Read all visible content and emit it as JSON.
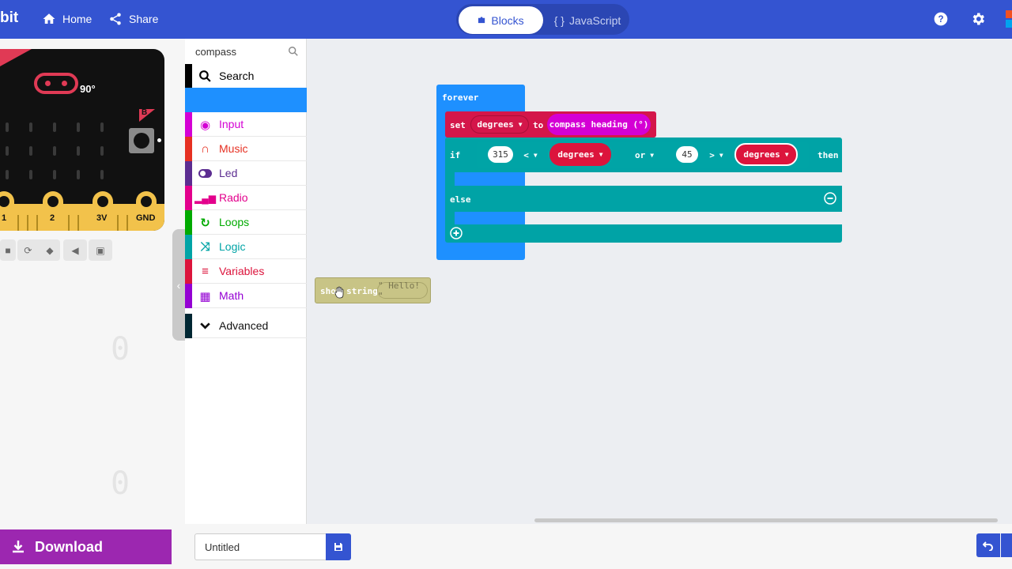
{
  "header": {
    "brand": "bit",
    "nav": [
      {
        "label": "Home",
        "icon": "home-icon"
      },
      {
        "label": "Share",
        "icon": "share-icon"
      }
    ],
    "mode_tabs": [
      {
        "label": "Blocks",
        "icon": "puzzle-icon",
        "active": true
      },
      {
        "label": "JavaScript",
        "icon": "code-braces-icon",
        "active": false
      }
    ],
    "right_icons": [
      "help-icon",
      "gear-icon"
    ],
    "colors": {
      "bar": "#3454d1"
    }
  },
  "simulator": {
    "heading_value": "90°",
    "button_b": "B",
    "pins": [
      "1",
      "2",
      "3V",
      "GND"
    ],
    "controls": [
      "stop-icon",
      "restart-icon",
      "slow-motion-icon",
      "mute-icon",
      "fullscreen-icon"
    ]
  },
  "toolbox": {
    "search_value": "compass",
    "categories": [
      {
        "label": "Search",
        "color": "#000000",
        "icon": "search-icon"
      },
      {
        "label": "Input",
        "color": "#d400d4",
        "icon": "input-icon"
      },
      {
        "label": "Music",
        "color": "#e63022",
        "icon": "headphones-icon"
      },
      {
        "label": "Led",
        "color": "#5c2d91",
        "icon": "toggle-icon"
      },
      {
        "label": "Radio",
        "color": "#e3008c",
        "icon": "signal-bars-icon"
      },
      {
        "label": "Loops",
        "color": "#00aa00",
        "icon": "loop-arrow-icon"
      },
      {
        "label": "Logic",
        "color": "#00a4a6",
        "icon": "shuffle-icon"
      },
      {
        "label": "Variables",
        "color": "#dc143c",
        "icon": "list-lines-icon"
      },
      {
        "label": "Math",
        "color": "#9400d3",
        "icon": "calculator-grid-icon"
      },
      {
        "label": "Advanced",
        "color": "#002733",
        "icon": "chevron-down-icon"
      }
    ]
  },
  "workspace": {
    "forever_label": "forever",
    "set_block": {
      "keyword": "set",
      "variable": "degrees",
      "to": "to",
      "value": "compass heading (°)"
    },
    "if_block": {
      "if": "if",
      "left_value": "315",
      "left_op": "<",
      "left_var": "degrees",
      "or": "or",
      "right_value": "45",
      "right_op": ">",
      "right_var": "degrees",
      "then": "then",
      "else": "else"
    },
    "show_string": {
      "label": "show string",
      "value": "\" Hello! \""
    }
  },
  "footer": {
    "download_label": "Download",
    "project_name": "Untitled"
  }
}
